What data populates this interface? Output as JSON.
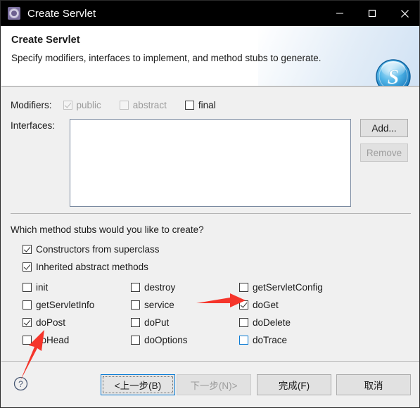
{
  "window": {
    "title": "Create Servlet",
    "icon": "eclipse-gear-icon",
    "controls": {
      "minimize": "minimize-icon",
      "maximize": "maximize-icon",
      "close": "close-icon"
    }
  },
  "banner": {
    "title": "Create Servlet",
    "description": "Specify modifiers, interfaces to implement, and method stubs to generate.",
    "logo": "servlet-s-logo",
    "logo_letter": "S"
  },
  "modifiers": {
    "label": "Modifiers:",
    "items": [
      {
        "label": "public",
        "checked": true,
        "enabled": false,
        "mnemonic": "p"
      },
      {
        "label": "abstract",
        "checked": false,
        "enabled": false,
        "mnemonic": "t"
      },
      {
        "label": "final",
        "checked": false,
        "enabled": true,
        "mnemonic": "l"
      }
    ]
  },
  "interfaces": {
    "label": "Interfaces:",
    "items": [],
    "add_button": "Add...",
    "remove_button": "Remove",
    "remove_enabled": false
  },
  "stubs": {
    "question": "Which method stubs would you like to create?",
    "top": [
      {
        "label": "Constructors from superclass",
        "checked": true
      },
      {
        "label": "Inherited abstract methods",
        "checked": true
      }
    ],
    "columns": [
      [
        {
          "label": "init",
          "checked": false,
          "focused": false
        },
        {
          "label": "getServletInfo",
          "checked": false,
          "focused": false
        },
        {
          "label": "doPost",
          "checked": true,
          "focused": false
        },
        {
          "label": "doHead",
          "checked": false,
          "focused": false
        }
      ],
      [
        {
          "label": "destroy",
          "checked": false,
          "focused": false
        },
        {
          "label": "service",
          "checked": false,
          "focused": false
        },
        {
          "label": "doPut",
          "checked": false,
          "focused": false
        },
        {
          "label": "doOptions",
          "checked": false,
          "focused": false
        }
      ],
      [
        {
          "label": "getServletConfig",
          "checked": false,
          "focused": false
        },
        {
          "label": "doGet",
          "checked": true,
          "focused": false
        },
        {
          "label": "doDelete",
          "checked": false,
          "focused": false
        },
        {
          "label": "doTrace",
          "checked": false,
          "focused": true
        }
      ]
    ]
  },
  "footer": {
    "help": "help-icon",
    "buttons": [
      {
        "label": "<上一步(B)",
        "state": "default"
      },
      {
        "label": "下一步(N)>",
        "state": "disabled"
      },
      {
        "label": "完成(F)",
        "state": "normal"
      },
      {
        "label": "取消",
        "state": "normal"
      }
    ]
  },
  "annotations": {
    "color": "#f5352b",
    "arrows": [
      {
        "name": "arrow-to-doget",
        "direction": "right"
      },
      {
        "name": "arrow-to-dohead",
        "direction": "up-right"
      }
    ]
  }
}
